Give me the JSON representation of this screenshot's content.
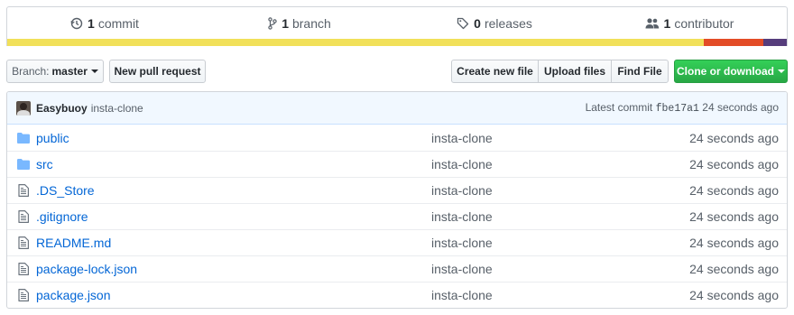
{
  "summary": {
    "commits": {
      "count": "1",
      "label": "commit",
      "icon": "history-icon"
    },
    "branches": {
      "count": "1",
      "label": "branch",
      "icon": "branch-icon"
    },
    "releases": {
      "count": "0",
      "label": "releases",
      "icon": "tag-icon"
    },
    "contributors": {
      "count": "1",
      "label": "contributor",
      "icon": "people-icon"
    }
  },
  "language_bar": {
    "colors": [
      "#f1e05a",
      "#e34c26",
      "#563d7c"
    ],
    "shares": [
      0.894,
      0.076,
      0.03
    ]
  },
  "toolbar": {
    "branch_prefix": "Branch:",
    "branch_name": "master",
    "new_pull_request": "New pull request",
    "create_new_file": "Create new file",
    "upload_files": "Upload files",
    "find_file": "Find File",
    "clone_or_download": "Clone or download"
  },
  "commit_tease": {
    "author": "Easybuoy",
    "message": "insta-clone",
    "latest_label": "Latest commit",
    "sha": "fbe17a1",
    "age": "24 seconds ago"
  },
  "files": [
    {
      "type": "dir",
      "icon": "folder-icon",
      "name": "public",
      "message": "insta-clone",
      "age": "24 seconds ago"
    },
    {
      "type": "dir",
      "icon": "folder-icon",
      "name": "src",
      "message": "insta-clone",
      "age": "24 seconds ago"
    },
    {
      "type": "file",
      "icon": "file-icon",
      "name": ".DS_Store",
      "message": "insta-clone",
      "age": "24 seconds ago"
    },
    {
      "type": "file",
      "icon": "file-icon",
      "name": ".gitignore",
      "message": "insta-clone",
      "age": "24 seconds ago"
    },
    {
      "type": "file",
      "icon": "file-icon",
      "name": "README.md",
      "message": "insta-clone",
      "age": "24 seconds ago"
    },
    {
      "type": "file",
      "icon": "file-icon",
      "name": "package-lock.json",
      "message": "insta-clone",
      "age": "24 seconds ago"
    },
    {
      "type": "file",
      "icon": "file-icon",
      "name": "package.json",
      "message": "insta-clone",
      "age": "24 seconds ago"
    }
  ]
}
